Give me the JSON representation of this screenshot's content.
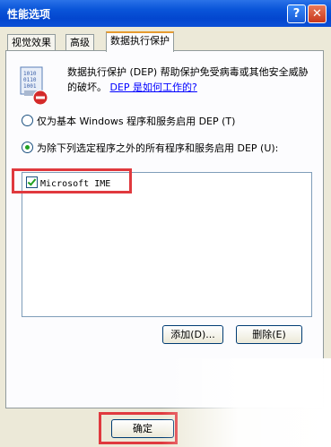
{
  "window": {
    "title": "性能选项"
  },
  "title_buttons": {
    "help": "?",
    "close": "✕"
  },
  "tabs": [
    {
      "label": "视觉效果"
    },
    {
      "label": "高级"
    },
    {
      "label": "数据执行保护"
    }
  ],
  "dep": {
    "description": "数据执行保护 (DEP) 帮助保护免受病毒或其他安全威胁的破坏。",
    "link": "DEP 是如何工作的?",
    "icon": "dep-shield-icon"
  },
  "options": [
    {
      "label": "仅为基本 Windows 程序和服务启用 DEP (T)",
      "selected": false
    },
    {
      "label": "为除下列选定程序之外的所有程序和服务启用 DEP (U):",
      "selected": true
    }
  ],
  "program_list": [
    {
      "name": "Microsoft IME",
      "checked": true
    }
  ],
  "buttons": {
    "add": "添加(D)...",
    "remove": "删除(E)",
    "ok": "确定"
  },
  "colors": {
    "titlebar": "#0a55d9",
    "highlight_box": "#e0393e",
    "tab_accent": "#e69b2f"
  }
}
